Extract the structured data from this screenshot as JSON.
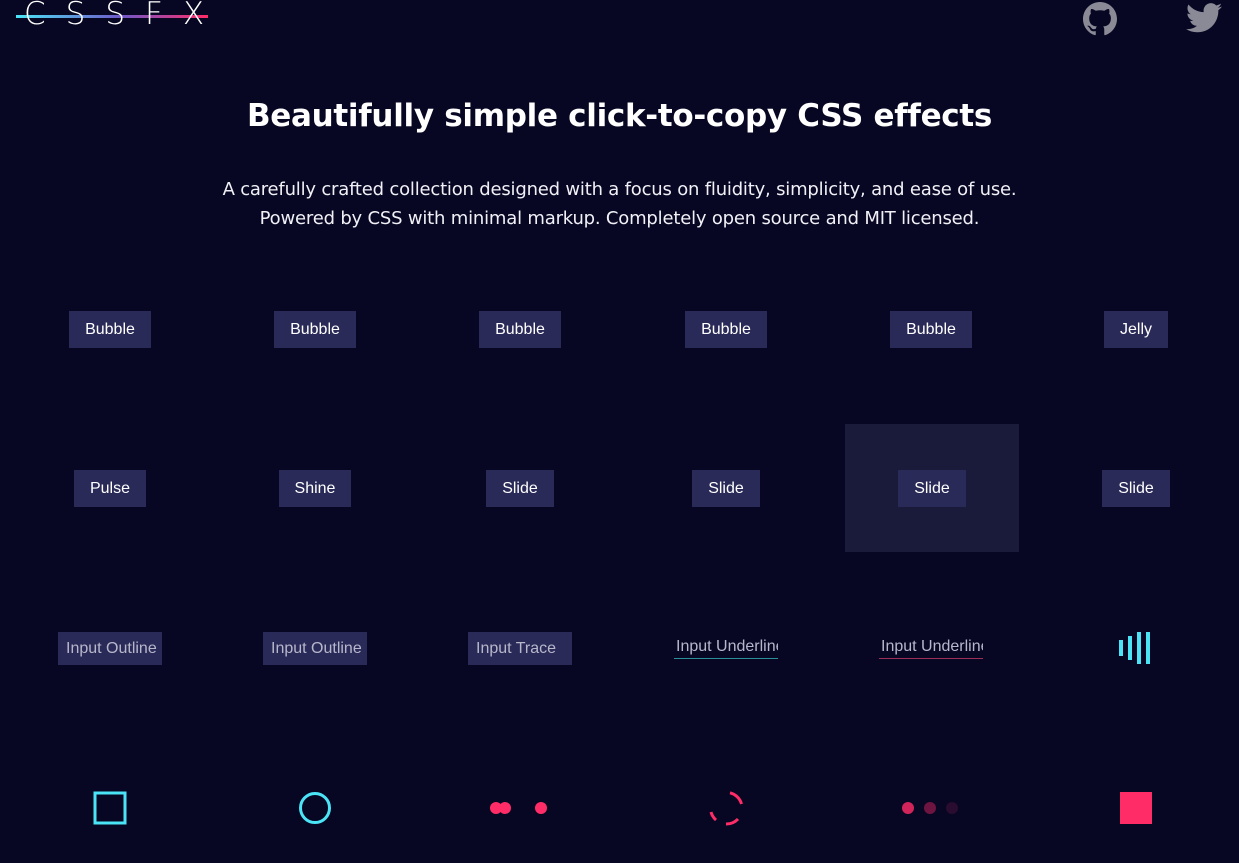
{
  "header": {
    "logo": "CSSFX",
    "icons": [
      "github-icon",
      "twitter-icon"
    ]
  },
  "hero": {
    "title": "Beautifully simple click-to-copy CSS effects",
    "subtitle_line1": "A carefully crafted collection designed with a focus on fluidity, simplicity, and ease of use.",
    "subtitle_line2": "Powered by CSS with minimal markup. Completely open source and MIT licensed."
  },
  "effects": {
    "row1": [
      "Bubble",
      "Bubble",
      "Bubble",
      "Bubble",
      "Bubble",
      "Jelly"
    ],
    "row2": [
      "Pulse",
      "Shine",
      "Slide",
      "Slide",
      "Slide",
      "Slide"
    ],
    "row3": [
      "Input Outline",
      "Input Outline",
      "Input Trace",
      "Input Underline",
      "Input Underline"
    ],
    "loaders": [
      "bars-loader",
      "square-loader",
      "circle-loader",
      "dots-bounce-loader",
      "spinner-arc-loader",
      "dots-fade-loader",
      "square-fill-loader"
    ]
  },
  "colors": {
    "background": "#070723",
    "button": "#2a2a58",
    "cyan": "#4be4f6",
    "pink": "#ff2c68"
  }
}
